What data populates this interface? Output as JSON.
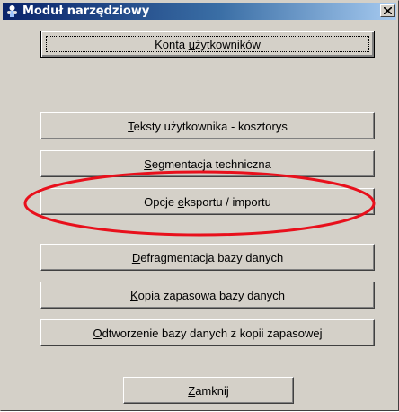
{
  "window": {
    "title": "Moduł narzędziowy"
  },
  "buttons": [
    {
      "key": "konta",
      "before": "Konta ",
      "accel": "u",
      "after": "żytkowników"
    },
    {
      "key": "teksty",
      "before": "",
      "accel": "T",
      "after": "eksty użytkownika - kosztorys"
    },
    {
      "key": "segmentacja",
      "before": "",
      "accel": "S",
      "after": "egmentacja techniczna"
    },
    {
      "key": "opcje",
      "before": "Opcje ",
      "accel": "e",
      "after": "ksportu / importu"
    },
    {
      "key": "defragmentacja",
      "before": "",
      "accel": "D",
      "after": "efragmentacja bazy danych"
    },
    {
      "key": "kopia",
      "before": "",
      "accel": "K",
      "after": "opia zapasowa bazy danych"
    },
    {
      "key": "odtworzenie",
      "before": "",
      "accel": "O",
      "after": "dtworzenie bazy danych z kopii zapasowej"
    },
    {
      "key": "zamknij",
      "before": "",
      "accel": "Z",
      "after": "amknij"
    }
  ],
  "annotation": {
    "color": "#e8101c"
  }
}
